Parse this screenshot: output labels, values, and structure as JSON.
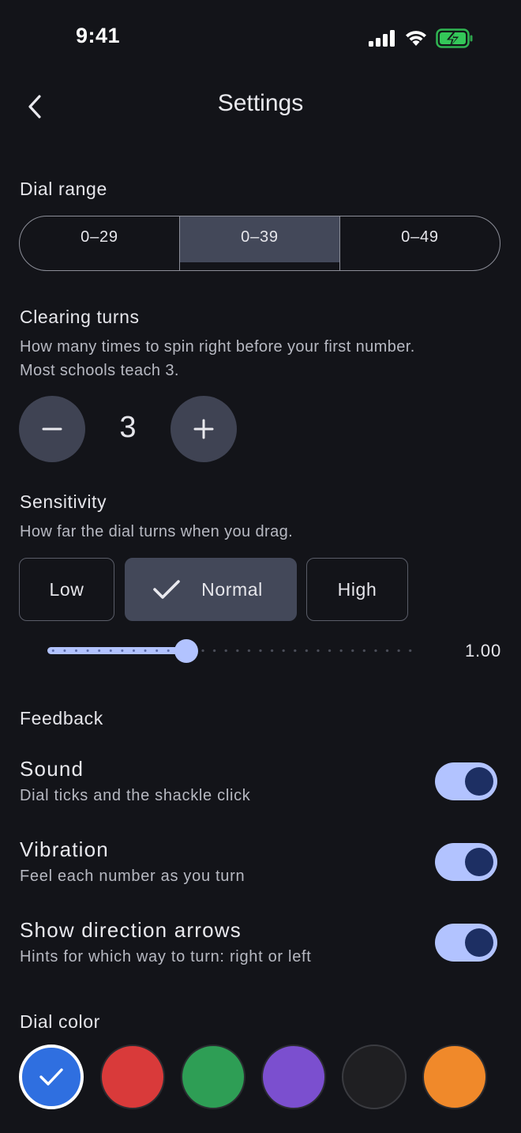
{
  "status_bar": {
    "time": "9:41",
    "icons": [
      "cellular-signal-icon",
      "wifi-icon",
      "battery-charging-icon"
    ],
    "battery_color": "#34C759"
  },
  "header": {
    "title": "Settings",
    "back_icon": "chevron-left-icon"
  },
  "dial_range": {
    "title": "Dial range",
    "options": [
      "0–29",
      "0–39",
      "0–49"
    ],
    "selected": "0–39"
  },
  "clearing_turns": {
    "title": "Clearing turns",
    "description_line1": "How many times to spin right before your first number.",
    "description_line2": "Most schools teach 3.",
    "value": "3",
    "decrement_icon": "minus-icon",
    "increment_icon": "plus-icon"
  },
  "sensitivity": {
    "title": "Sensitivity",
    "description": "How far the dial turns when you drag.",
    "options": [
      "Low",
      "Normal",
      "High"
    ],
    "selected": "Normal",
    "slider_value_label": "1.00",
    "slider_fraction": 0.375
  },
  "feedback": {
    "title": "Feedback",
    "items": [
      {
        "label": "Sound",
        "description": "Dial ticks and the shackle click",
        "enabled": true
      },
      {
        "label": "Vibration",
        "description": "Feel each number as you turn",
        "enabled": true
      },
      {
        "label": "Show direction arrows",
        "description": "Hints for which way to turn: right or left",
        "enabled": true
      }
    ]
  },
  "dial_color": {
    "title": "Dial color",
    "swatches": [
      "#2F6FE0",
      "#D93A3A",
      "#2E9E55",
      "#7B4FCF",
      "#1F1F22",
      "#F0892A"
    ],
    "selected_index": 0
  },
  "colors": {
    "background": "#131419",
    "accent": "#B2C3FF",
    "selected_fill": "#434859"
  }
}
